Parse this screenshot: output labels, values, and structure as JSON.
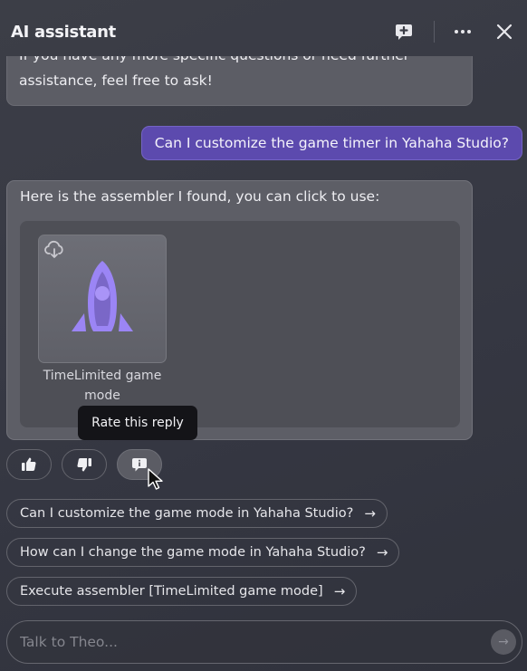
{
  "header": {
    "title": "AI assistant",
    "icons": {
      "new_chat": "message-plus-icon",
      "more": "more-horizontal-icon",
      "close": "close-icon"
    }
  },
  "messages": [
    {
      "role": "assistant",
      "lines": [
        "If you have any more specific questions or need further",
        "assistance, feel free to ask!"
      ]
    },
    {
      "role": "user",
      "text": "Can I customize the game timer in Yahaha Studio?"
    },
    {
      "role": "assistant",
      "text": "Here is the assembler I found, you can click to use:",
      "assemblers": [
        {
          "name": "TimeLimited game mode",
          "icon": "rocket-icon",
          "badge_icon": "cloud-download-icon"
        }
      ]
    }
  ],
  "tooltip": {
    "text": "Rate this reply"
  },
  "rating": {
    "buttons": [
      {
        "name": "thumbs-up",
        "icon": "thumbs-up-icon"
      },
      {
        "name": "thumbs-down",
        "icon": "thumbs-down-icon"
      },
      {
        "name": "rate-reply",
        "icon": "feedback-icon",
        "active": true
      }
    ]
  },
  "suggestions": [
    {
      "text": "Can I customize the game mode in Yahaha Studio?",
      "arrow": "→"
    },
    {
      "text": "How can I change the game mode in Yahaha Studio?",
      "arrow": "→"
    },
    {
      "text": "Execute assembler [TimeLimited game mode]",
      "arrow": "→"
    }
  ],
  "input": {
    "placeholder": "Talk to Theo...",
    "value": "",
    "send_icon": "→"
  },
  "colors": {
    "user_bubble": "#5c4aae",
    "accent_rocket": "#9b85f5"
  }
}
